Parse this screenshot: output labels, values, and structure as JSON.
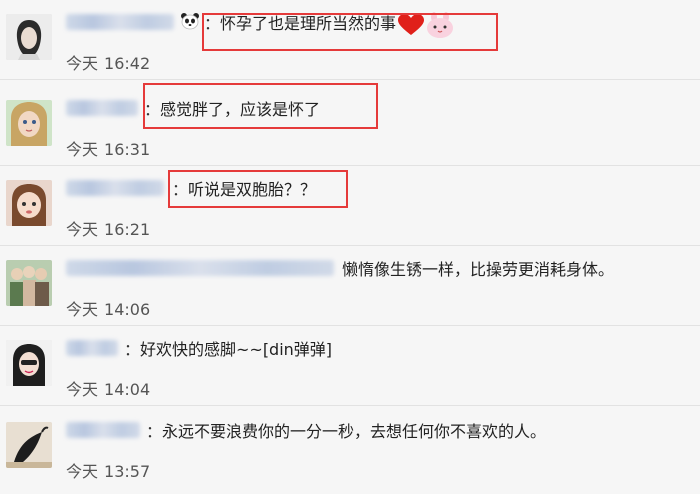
{
  "comments": [
    {
      "time_day": "今天",
      "time_clock": "16:42",
      "text": "怀孕了也是理所当然的事",
      "emoji": [
        "heart-icon",
        "bunny-face-icon"
      ]
    },
    {
      "time_day": "今天",
      "time_clock": "16:31",
      "text": "感觉胖了，应该是怀了"
    },
    {
      "time_day": "今天",
      "time_clock": "16:21",
      "text": "听说是双胞胎？？"
    },
    {
      "time_day": "今天",
      "time_clock": "14:06",
      "text": "懒惰像生锈一样，比操劳更消耗身体。"
    },
    {
      "time_day": "今天",
      "time_clock": "14:04",
      "text": "好欢快的感脚~~[din弹弹]"
    },
    {
      "time_day": "今天",
      "time_clock": "13:57",
      "text": "永远不要浪费你的一分一秒，去想任何你不喜欢的人。"
    }
  ],
  "colon": "：",
  "highlight_color": "#e53a3a"
}
